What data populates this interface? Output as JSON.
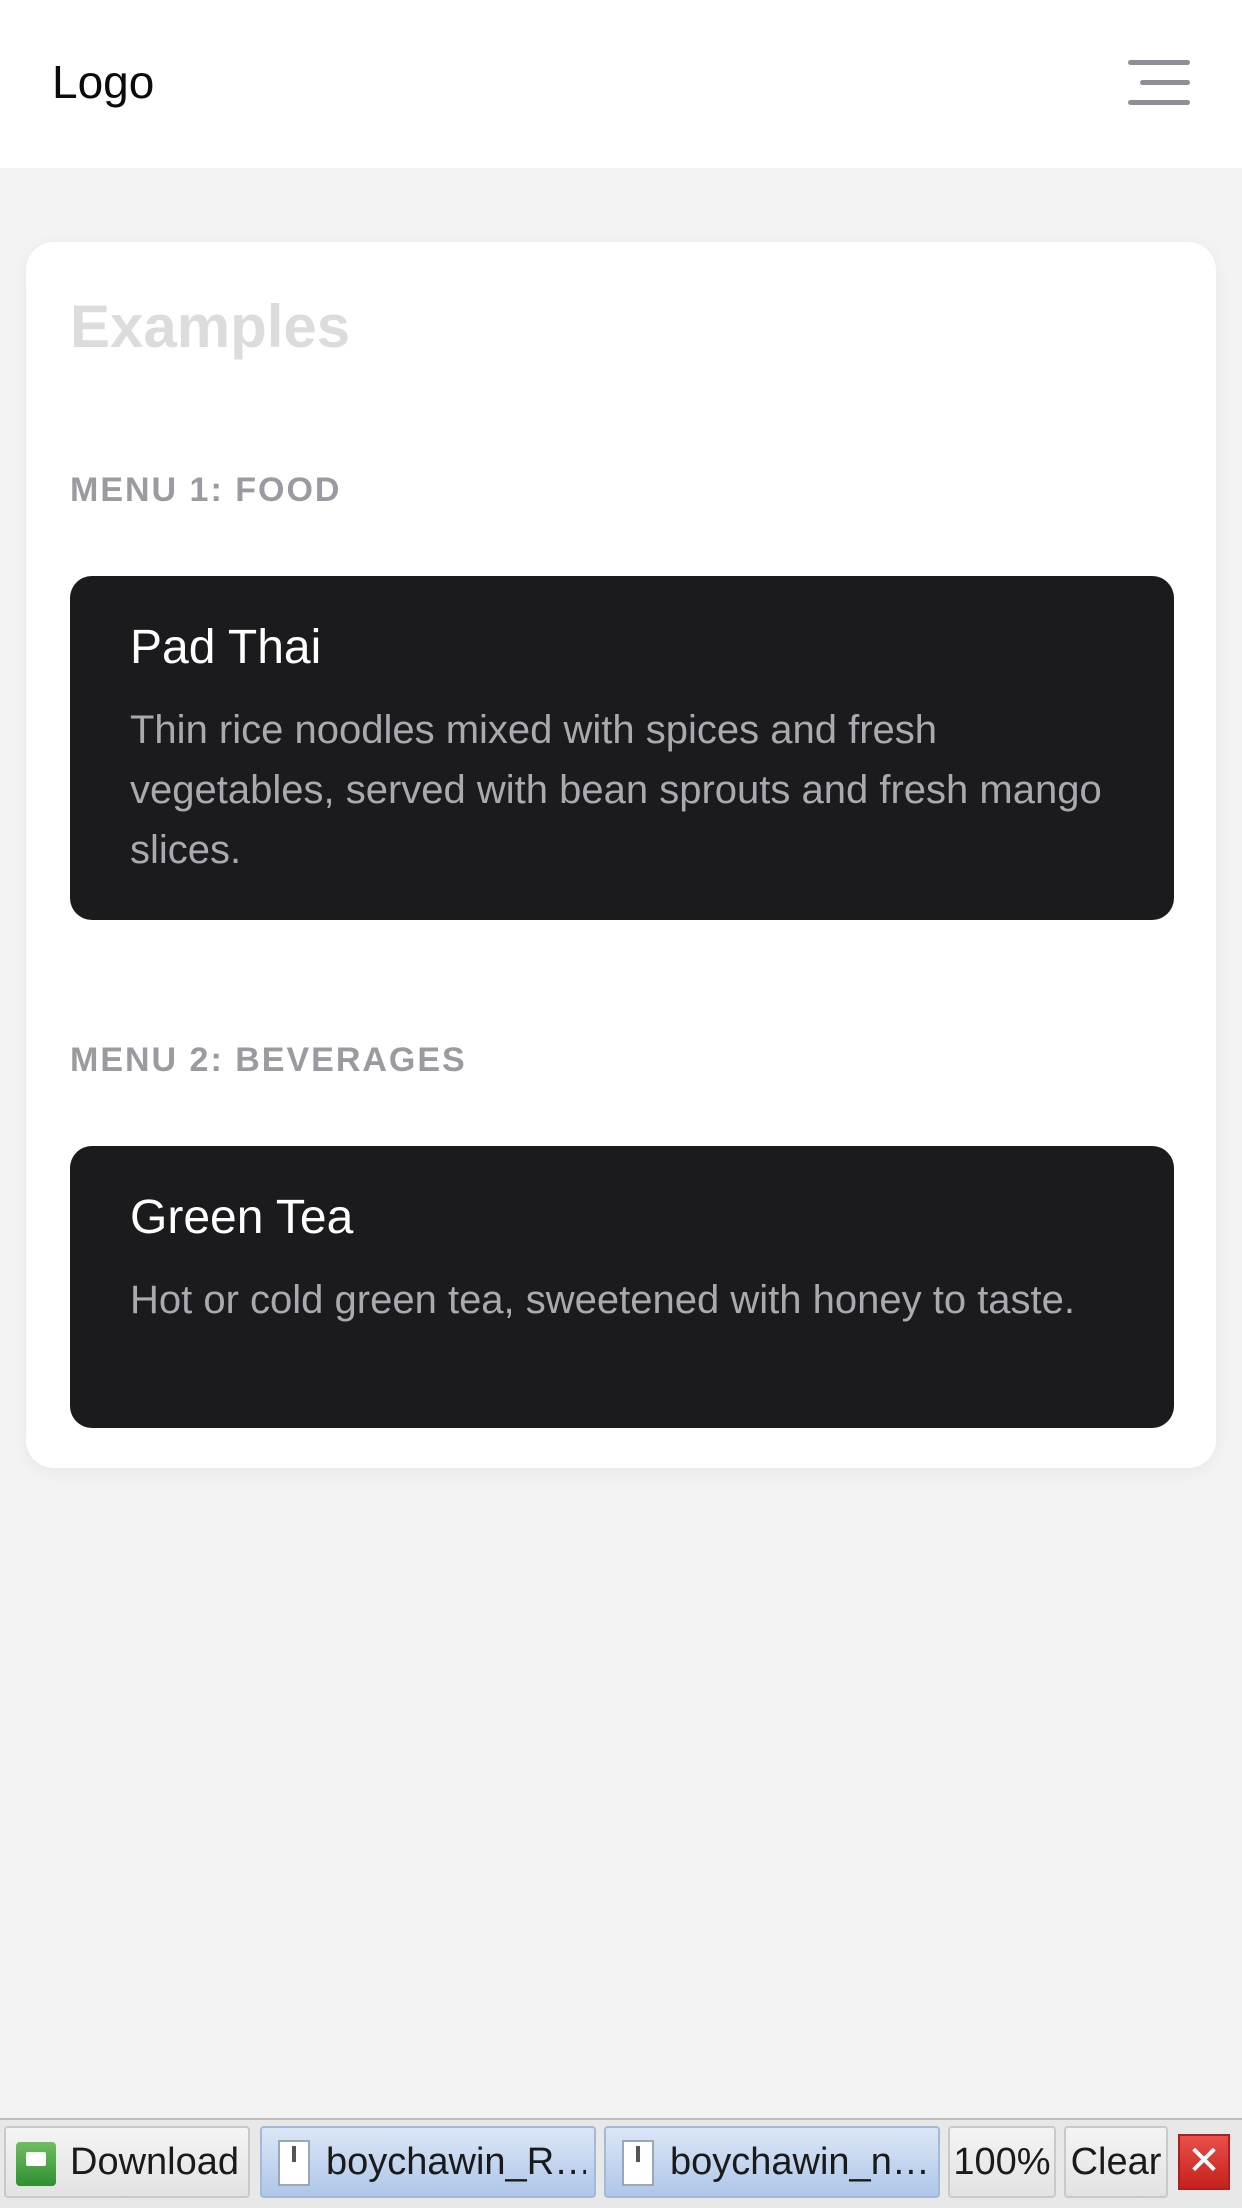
{
  "header": {
    "logo": "Logo",
    "menu_icon": "hamburger-menu-icon"
  },
  "examples": {
    "title": "Examples",
    "sections": [
      {
        "label": "MENU 1: FOOD",
        "item": {
          "name": "Pad Thai",
          "description": "Thin rice noodles mixed with spices and fresh vegetables, served with bean sprouts and fresh mango slices."
        }
      },
      {
        "label": "MENU 2: BEVERAGES",
        "item": {
          "name": "Green Tea",
          "description": "Hot or cold green tea, sweetened with honey to taste."
        }
      }
    ]
  },
  "downloads_bar": {
    "downloads_label": "Downloads",
    "files": [
      "boychawin_R…",
      "boychawin_n…"
    ],
    "zoom": "100%",
    "clear_label": "Clear",
    "close_glyph": "✕"
  },
  "colors": {
    "page_background": "#f3f3f4",
    "card_background": "#ffffff",
    "item_background": "#1b1b1e",
    "section_label": "#9a9aa1",
    "title_muted": "#dcdcdf"
  }
}
